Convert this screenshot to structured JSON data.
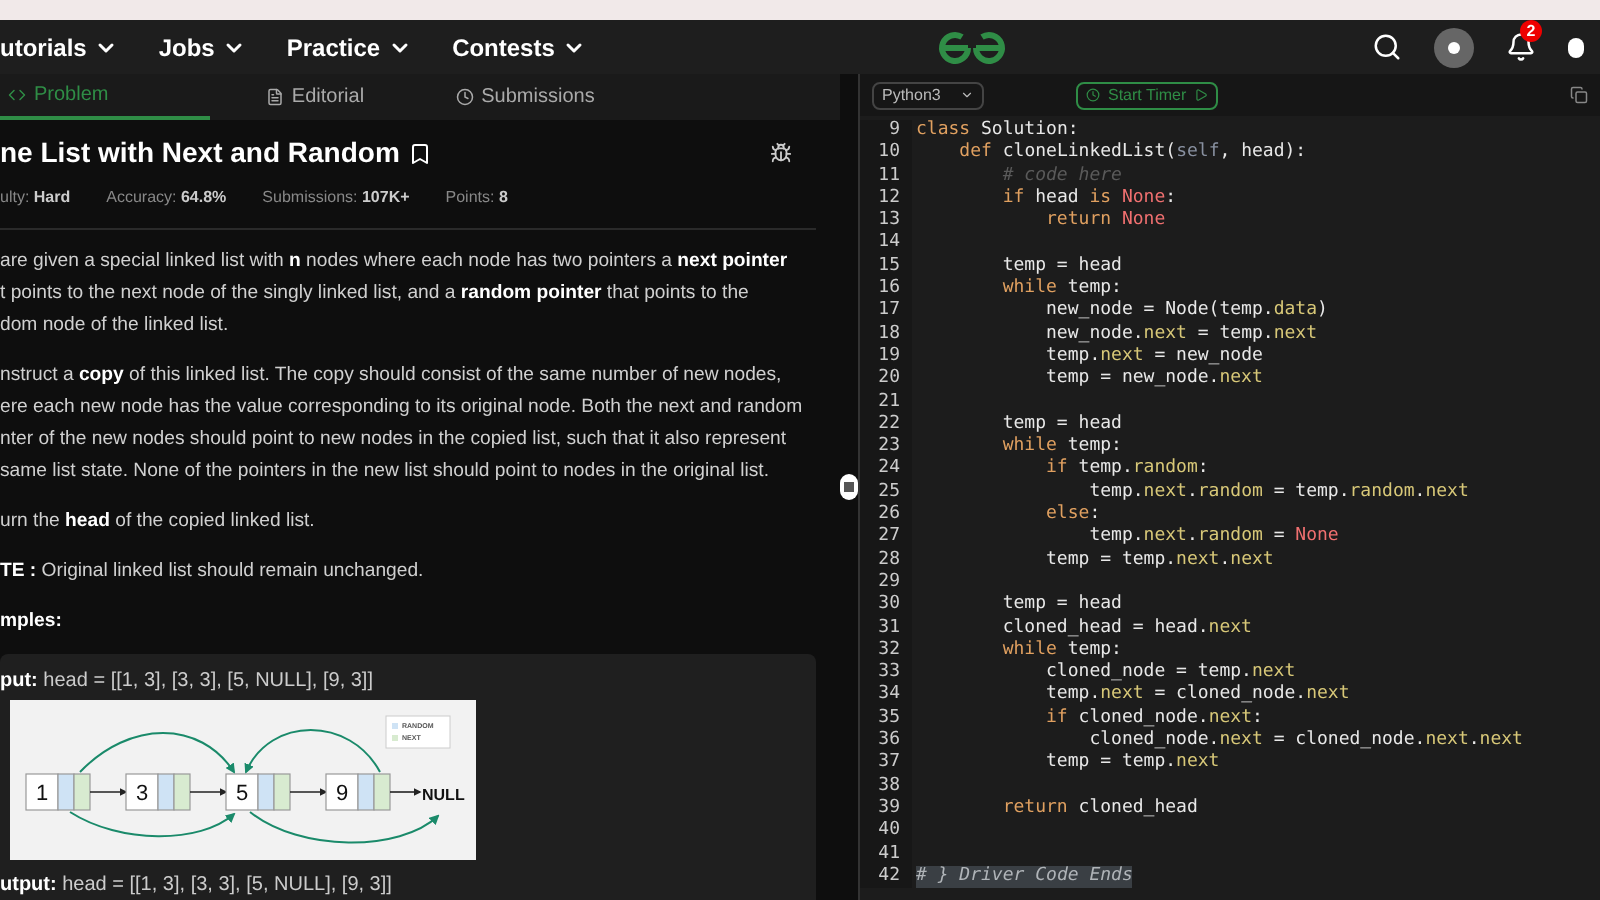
{
  "nav": {
    "menus": [
      "utorials",
      "Jobs",
      "Practice",
      "Contests"
    ],
    "notifications": "2"
  },
  "tabs": [
    {
      "label": "Problem",
      "selected": true
    },
    {
      "label": "Editorial",
      "selected": false
    },
    {
      "label": "Submissions",
      "selected": false
    }
  ],
  "problem": {
    "title": "ne List with Next and Random",
    "meta": [
      "ulty: **Hard**",
      "Accuracy: **64.8%**",
      "Submissions: **107K+**",
      "Points: **8**"
    ],
    "paragraphs": [
      [
        "are given a special linked list with **n** nodes where each node has two pointers a **next pointer**",
        "t points to the next node of the singly linked list, and a **random pointer** that points to the",
        "dom node of the linked list."
      ],
      [
        "nstruct a **copy** of this linked list. The copy should consist of the same number of new nodes,",
        "ere each new node has the value corresponding to its original node. Both the next and random",
        "nter of the new nodes should point to new nodes in the copied list, such that it also represent",
        "same list state. None of the pointers in the new list should point to nodes in the original list."
      ],
      [
        "urn the **head** of the copied linked list."
      ],
      [
        "**TE :** Original linked list should remain unchanged."
      ]
    ],
    "examples_heading": "mples:",
    "example": {
      "input_label": "put:",
      "input": "head = [[1, 3], [3, 3], [5, NULL], [9, 3]]",
      "diagram": {
        "legend": [
          "RANDOM",
          "NEXT"
        ],
        "nodes": [
          "1",
          "3",
          "5",
          "9"
        ],
        "end": "NULL"
      },
      "output_label": "utput:",
      "output": "head = [[1, 3], [3, 3], [5, NULL], [9, 3]]"
    }
  },
  "editor": {
    "language": "Python3",
    "timer_button": "Start Timer",
    "lines": [
      {
        "n": "9",
        "tokens": [
          {
            "kind": "kw",
            "text": "class"
          },
          {
            "kind": "p",
            "text": " Solution:"
          }
        ],
        "children": [
          {
            "n": "10",
            "tokens": [
              {
                "kind": "kw",
                "text": "def"
              },
              {
                "kind": "p",
                "text": " cloneLinkedList("
              },
              {
                "kind": "self",
                "text": "self"
              },
              {
                "kind": "p",
                "text": ", head):"
              }
            ],
            "children": [
              {
                "n": "11",
                "tokens": [
                  {
                    "kind": "cm",
                    "text": "# code here"
                  }
                ]
              },
              {
                "n": "12",
                "tokens": [
                  {
                    "kind": "kw",
                    "text": "if"
                  },
                  {
                    "kind": "p",
                    "text": " head "
                  },
                  {
                    "kind": "kw",
                    "text": "is "
                  },
                  {
                    "kind": "const",
                    "text": "None"
                  },
                  {
                    "kind": "p",
                    "text": ":"
                  }
                ],
                "children": [
                  {
                    "n": "13",
                    "tokens": [
                      {
                        "kind": "kw",
                        "text": "return "
                      },
                      {
                        "kind": "const",
                        "text": "None"
                      }
                    ]
                  }
                ]
              },
              {
                "n": "14"
              },
              {
                "n": "15",
                "tokens": [
                  {
                    "kind": "p",
                    "text": "temp = head"
                  }
                ]
              },
              {
                "n": "16",
                "tokens": [
                  {
                    "kind": "kw",
                    "text": "while"
                  },
                  {
                    "kind": "p",
                    "text": " temp:"
                  }
                ],
                "children": [
                  {
                    "n": "17",
                    "tokens": [
                      {
                        "kind": "p",
                        "text": "new_node = Node(temp."
                      },
                      {
                        "kind": "at",
                        "text": "data"
                      },
                      {
                        "kind": "p",
                        "text": ")"
                      }
                    ]
                  },
                  {
                    "n": "18",
                    "tokens": [
                      {
                        "kind": "p",
                        "text": "new_node."
                      },
                      {
                        "kind": "at",
                        "text": "next"
                      },
                      {
                        "kind": "p",
                        "text": " = temp."
                      },
                      {
                        "kind": "at",
                        "text": "next"
                      }
                    ]
                  },
                  {
                    "n": "19",
                    "tokens": [
                      {
                        "kind": "p",
                        "text": "temp."
                      },
                      {
                        "kind": "at",
                        "text": "next"
                      },
                      {
                        "kind": "p",
                        "text": " = new_node"
                      }
                    ]
                  },
                  {
                    "n": "20",
                    "tokens": [
                      {
                        "kind": "p",
                        "text": "temp = new_node."
                      },
                      {
                        "kind": "at",
                        "text": "next"
                      }
                    ]
                  }
                ]
              },
              {
                "n": "21"
              },
              {
                "n": "22",
                "tokens": [
                  {
                    "kind": "p",
                    "text": "temp = head"
                  }
                ]
              },
              {
                "n": "23",
                "tokens": [
                  {
                    "kind": "kw",
                    "text": "while"
                  },
                  {
                    "kind": "p",
                    "text": " temp:"
                  }
                ],
                "children": [
                  {
                    "n": "24",
                    "tokens": [
                      {
                        "kind": "kw",
                        "text": "if"
                      },
                      {
                        "kind": "p",
                        "text": " temp."
                      },
                      {
                        "kind": "at",
                        "text": "random"
                      },
                      {
                        "kind": "p",
                        "text": ":"
                      }
                    ],
                    "children": [
                      {
                        "n": "25",
                        "tokens": [
                          {
                            "kind": "p",
                            "text": "temp."
                          },
                          {
                            "kind": "at",
                            "text": "next"
                          },
                          {
                            "kind": "p",
                            "text": "."
                          },
                          {
                            "kind": "at",
                            "text": "random"
                          },
                          {
                            "kind": "p",
                            "text": " = temp."
                          },
                          {
                            "kind": "at",
                            "text": "random"
                          },
                          {
                            "kind": "p",
                            "text": "."
                          },
                          {
                            "kind": "at",
                            "text": "next"
                          }
                        ]
                      }
                    ]
                  },
                  {
                    "n": "26",
                    "tokens": [
                      {
                        "kind": "kw",
                        "text": "else"
                      },
                      {
                        "kind": "p",
                        "text": ":"
                      }
                    ],
                    "children": [
                      {
                        "n": "27",
                        "tokens": [
                          {
                            "kind": "p",
                            "text": "temp."
                          },
                          {
                            "kind": "at",
                            "text": "next"
                          },
                          {
                            "kind": "p",
                            "text": "."
                          },
                          {
                            "kind": "at",
                            "text": "random"
                          },
                          {
                            "kind": "p",
                            "text": " = "
                          },
                          {
                            "kind": "const",
                            "text": "None"
                          }
                        ]
                      }
                    ]
                  },
                  {
                    "n": "28",
                    "tokens": [
                      {
                        "kind": "p",
                        "text": "temp = temp."
                      },
                      {
                        "kind": "at",
                        "text": "next"
                      },
                      {
                        "kind": "p",
                        "text": "."
                      },
                      {
                        "kind": "at",
                        "text": "next"
                      }
                    ]
                  }
                ]
              },
              {
                "n": "29"
              },
              {
                "n": "30",
                "tokens": [
                  {
                    "kind": "p",
                    "text": "temp = head"
                  }
                ]
              },
              {
                "n": "31",
                "tokens": [
                  {
                    "kind": "p",
                    "text": "cloned_head = head."
                  },
                  {
                    "kind": "at",
                    "text": "next"
                  }
                ]
              },
              {
                "n": "32",
                "tokens": [
                  {
                    "kind": "kw",
                    "text": "while"
                  },
                  {
                    "kind": "p",
                    "text": " temp:"
                  }
                ],
                "children": [
                  {
                    "n": "33",
                    "tokens": [
                      {
                        "kind": "p",
                        "text": "cloned_node = temp."
                      },
                      {
                        "kind": "at",
                        "text": "next"
                      }
                    ]
                  },
                  {
                    "n": "34",
                    "tokens": [
                      {
                        "kind": "p",
                        "text": "temp."
                      },
                      {
                        "kind": "at",
                        "text": "next"
                      },
                      {
                        "kind": "p",
                        "text": " = cloned_node."
                      },
                      {
                        "kind": "at",
                        "text": "next"
                      }
                    ]
                  },
                  {
                    "n": "35",
                    "tokens": [
                      {
                        "kind": "kw",
                        "text": "if"
                      },
                      {
                        "kind": "p",
                        "text": " cloned_node."
                      },
                      {
                        "kind": "at",
                        "text": "next"
                      },
                      {
                        "kind": "p",
                        "text": ":"
                      }
                    ],
                    "children": [
                      {
                        "n": "36",
                        "tokens": [
                          {
                            "kind": "p",
                            "text": "cloned_node."
                          },
                          {
                            "kind": "at",
                            "text": "next"
                          },
                          {
                            "kind": "p",
                            "text": " = cloned_node."
                          },
                          {
                            "kind": "at",
                            "text": "next"
                          },
                          {
                            "kind": "p",
                            "text": "."
                          },
                          {
                            "kind": "at",
                            "text": "next"
                          }
                        ]
                      }
                    ]
                  },
                  {
                    "n": "37",
                    "tokens": [
                      {
                        "kind": "p",
                        "text": "temp = temp."
                      },
                      {
                        "kind": "at",
                        "text": "next"
                      }
                    ]
                  }
                ]
              },
              {
                "n": "38"
              },
              {
                "n": "39",
                "tokens": [
                  {
                    "kind": "kw",
                    "text": "return"
                  },
                  {
                    "kind": "p",
                    "text": " cloned_head"
                  }
                ]
              },
              {
                "n": "40"
              },
              {
                "n": "41"
              }
            ]
          }
        ]
      },
      {
        "n": "42",
        "highlighted": true,
        "tokens": [
          {
            "kind": "cm",
            "text": "# } Driver Code Ends"
          }
        ]
      }
    ]
  }
}
